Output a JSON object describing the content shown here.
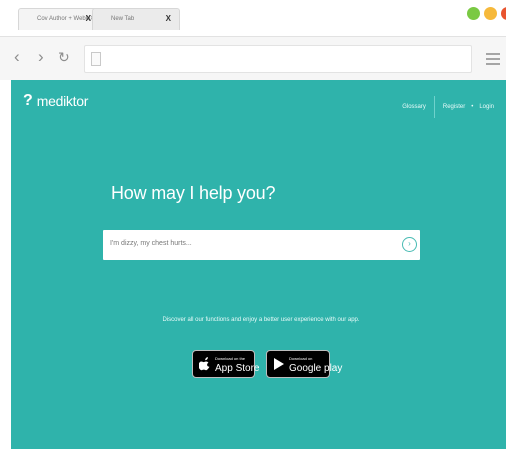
{
  "browser": {
    "tabs": [
      {
        "title": "Cov Author + WebUX",
        "close": "X",
        "active": true
      },
      {
        "title": "New Tab",
        "close": "X",
        "active": false
      }
    ],
    "toolbar": {
      "back": "‹",
      "forward": "›",
      "reload": "↻"
    }
  },
  "app": {
    "logo": {
      "mark": "?",
      "text": "mediktor"
    },
    "nav": {
      "glossary": "Glossary",
      "register": "Register",
      "dot": "•",
      "login": "Login"
    },
    "headline": "How may I help you?",
    "search": {
      "placeholder": "I'm dizzy, my chest hurts...",
      "go_icon": "›"
    },
    "promo": "Discover all our functions and enjoy a better user experience with our app.",
    "app_store": {
      "small": "Download on the",
      "big": "App Store"
    },
    "google_play": {
      "small": "Download on",
      "big": "Google play"
    }
  },
  "colors": {
    "accent": "#2fb3ab",
    "traffic_green": "#7ac943",
    "traffic_yellow": "#f6b93b",
    "traffic_red": "#e8542f"
  }
}
